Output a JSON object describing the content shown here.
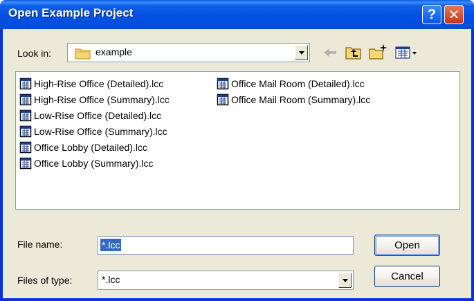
{
  "window": {
    "title": "Open Example Project"
  },
  "titlebar": {
    "help_glyph": "?",
    "close_glyph": "✕"
  },
  "lookin": {
    "label": "Look in:",
    "value": "example",
    "icon": "folder-icon"
  },
  "toolbar": {
    "icons": [
      "back-arrow-icon",
      "up-one-level-icon",
      "create-new-folder-icon",
      "view-menu-icon"
    ]
  },
  "files": {
    "column1": [
      "High-Rise Office (Detailed).lcc",
      "High-Rise Office (Summary).lcc",
      "Low-Rise Office (Detailed).lcc",
      "Low-Rise Office (Summary).lcc",
      "Office Lobby (Detailed).lcc",
      "Office Lobby (Summary).lcc"
    ],
    "column2": [
      "Office Mail Room (Detailed).lcc",
      "Office Mail Room (Summary).lcc"
    ]
  },
  "filename": {
    "label": "File name:",
    "value": "*.lcc"
  },
  "filetype": {
    "label": "Files of type:",
    "value": "*.lcc"
  },
  "buttons": {
    "open": "Open",
    "cancel": "Cancel"
  },
  "colors": {
    "titlebar": "#0450e0",
    "dialog_bg": "#ece9d8",
    "selection": "#316ac5",
    "close_button": "#c33516"
  }
}
